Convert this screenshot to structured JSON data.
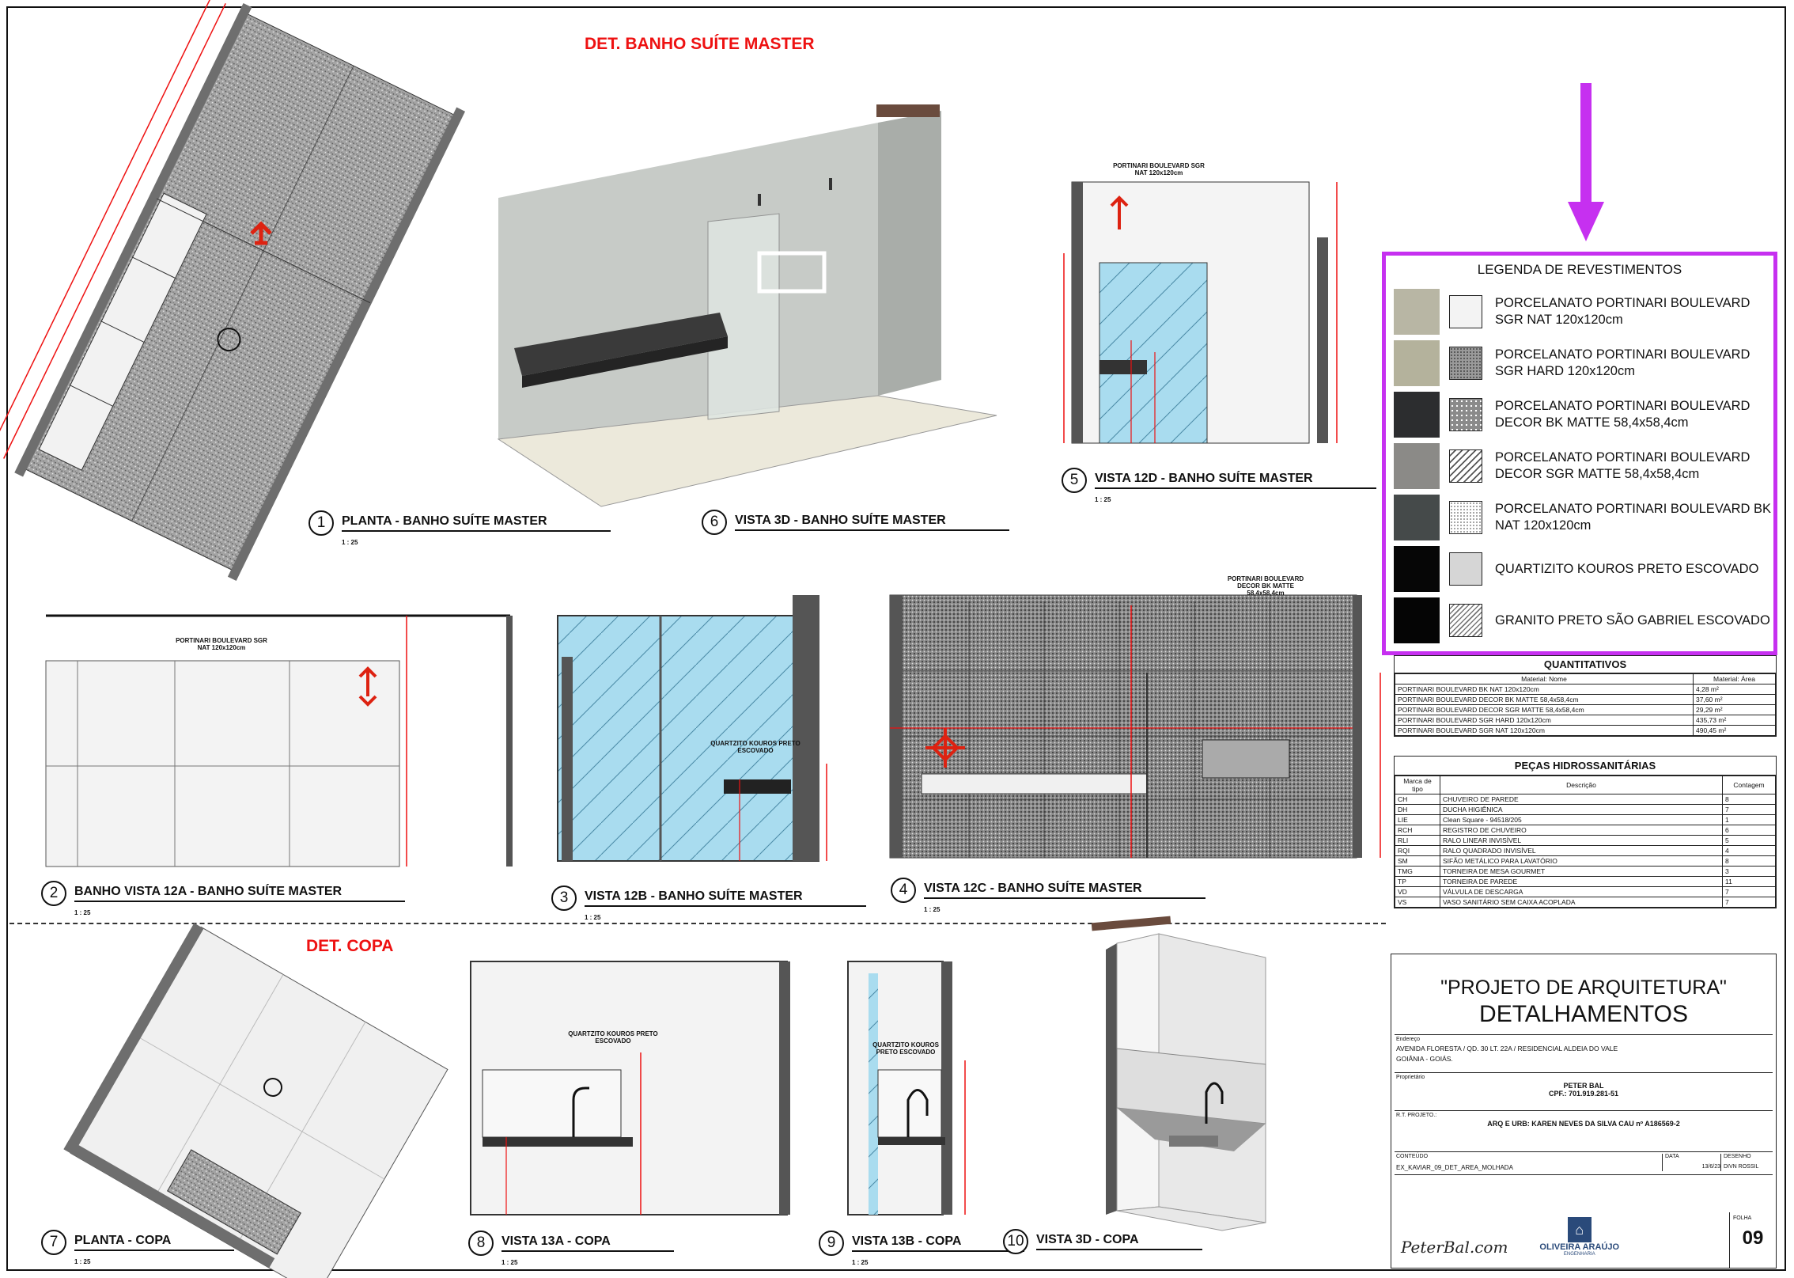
{
  "sections": {
    "bath_title": "DET. BANHO SUÍTE MASTER",
    "copa_title": "DET. COPA"
  },
  "views": [
    {
      "num": "1",
      "title": "PLANTA - BANHO SUÍTE MASTER",
      "scale": "1 : 25"
    },
    {
      "num": "6",
      "title": "VISTA 3D - BANHO SUÍTE MASTER",
      "scale": ""
    },
    {
      "num": "5",
      "title": "VISTA 12D - BANHO SUÍTE MASTER",
      "scale": "1 : 25"
    },
    {
      "num": "2",
      "title": "BANHO VISTA 12A - BANHO SUÍTE MASTER",
      "scale": "1 : 25"
    },
    {
      "num": "3",
      "title": "VISTA 12B - BANHO SUÍTE MASTER",
      "scale": "1 : 25"
    },
    {
      "num": "4",
      "title": "VISTA 12C - BANHO SUÍTE MASTER",
      "scale": "1 : 25"
    },
    {
      "num": "7",
      "title": "PLANTA - COPA",
      "scale": "1 : 25"
    },
    {
      "num": "8",
      "title": "VISTA 13A - COPA",
      "scale": "1 : 25"
    },
    {
      "num": "9",
      "title": "VISTA 13B - COPA",
      "scale": "1 : 25"
    },
    {
      "num": "10",
      "title": "VISTA 3D - COPA",
      "scale": ""
    }
  ],
  "notes": {
    "v5_top": "PORTINARI BOULEVARD SGR NAT 120x120cm",
    "v2_top": "PORTINARI BOULEVARD SGR NAT 120x120cm",
    "v3_side": "QUARTZITO KOUROS PRETO ESCOVADO",
    "v4_top": "PORTINARI BOULEVARD DECOR BK MATTE 58,4x58,4cm",
    "v8_note": "QUARTZITO KOUROS PRETO ESCOVADO",
    "v9_note": "QUARTZITO KOUROS PRETO ESCOVADO"
  },
  "legend": {
    "title": "LEGENDA DE REVESTIMENTOS",
    "items": [
      {
        "label": "PORCELANATO PORTINARI BOULEVARD SGR NAT 120x120cm",
        "color": "#b8b6a4",
        "pattern": "plain-light"
      },
      {
        "label": "PORCELANATO PORTINARI BOULEVARD SGR HARD 120x120cm",
        "color": "#b4b29c",
        "pattern": "speckle-dark"
      },
      {
        "label": "PORCELANATO PORTINARI BOULEVARD DECOR BK MATTE 58,4x58,4cm",
        "color": "#2c2d2f",
        "pattern": "dots"
      },
      {
        "label": "PORCELANATO PORTINARI BOULEVARD DECOR SGR MATTE 58,4x58,4cm",
        "color": "#8b8a87",
        "pattern": "hatch"
      },
      {
        "label": "PORCELANATO PORTINARI BOULEVARD BK NAT 120x120cm",
        "color": "#454a4a",
        "pattern": "fine-dots"
      },
      {
        "label": "QUARTIZITO KOUROS PRETO ESCOVADO",
        "color": "#060606",
        "pattern": "plain-gray"
      },
      {
        "label": "GRANITO PRETO SÃO GABRIEL ESCOVADO",
        "color": "#050505",
        "pattern": "hatch-fine"
      }
    ]
  },
  "quantitativos": {
    "title": "QUANTITATIVOS",
    "headers": [
      "Material: Nome",
      "Material: Área"
    ],
    "rows": [
      [
        "PORTINARI BOULEVARD BK NAT 120x120cm",
        "4,28 m²"
      ],
      [
        "PORTINARI BOULEVARD DECOR BK MATTE 58,4x58,4cm",
        "37,60 m²"
      ],
      [
        "PORTINARI BOULEVARD DECOR SGR MATTE 58,4x58,4cm",
        "29,29 m²"
      ],
      [
        "PORTINARI BOULEVARD SGR HARD 120x120cm",
        "435,73 m²"
      ],
      [
        "PORTINARI BOULEVARD SGR NAT 120x120cm",
        "490,45 m²"
      ]
    ]
  },
  "pecas": {
    "title": "PEÇAS HIDROSSANITÁRIAS",
    "headers": [
      "Marca de tipo",
      "Descrição",
      "Contagem"
    ],
    "rows": [
      [
        "CH",
        "CHUVEIRO DE PAREDE",
        "8"
      ],
      [
        "DH",
        "DUCHA HIGIÊNICA",
        "7"
      ],
      [
        "LIE",
        "Clean Square - 94518/205",
        "1"
      ],
      [
        "RCH",
        "REGISTRO DE CHUVEIRO",
        "6"
      ],
      [
        "RLI",
        "RALO LINEAR INVISÍVEL",
        "5"
      ],
      [
        "RQI",
        "RALO QUADRADO INVISÍVEL",
        "4"
      ],
      [
        "SM",
        "SIFÃO METÁLICO PARA LAVATÓRIO",
        "8"
      ],
      [
        "TMG",
        "TORNEIRA DE MESA GOURMET",
        "3"
      ],
      [
        "TP",
        "TORNEIRA DE PAREDE",
        "11"
      ],
      [
        "VD",
        "VÁLVULA DE DESCARGA",
        "7"
      ],
      [
        "VS",
        "VASO SANITÁRIO SEM CAIXA ACOPLADA",
        "7"
      ]
    ]
  },
  "title_block": {
    "project": "\"PROJETO DE ARQUITETURA\"",
    "subject": "DETALHAMENTOS",
    "address_label": "Endereço",
    "address1": "AVENIDA FLORESTA / QD. 30 LT. 22A / RESIDENCIAL ALDEIA DO VALE",
    "address2": "GOIÂNIA - GOIÁS.",
    "owner_label": "Proprietário",
    "owner_name": "PETER BAL",
    "owner_cpf": "CPF.: 701.919.281-51",
    "rt_label": "R.T. PROJETO.:",
    "rt_value": "ARQ E URB: KAREN NEVES DA SILVA CAU nº A186569-2",
    "file_label": "CONTEÚDO",
    "file_value": "EX_KAVIAR_09_DET_AREA_MOLHADA",
    "date_label": "DATA",
    "date_value": "13/6/23",
    "design_label": "DESENHO",
    "design_value": "DIVN ROSSIL",
    "sheet_label": "FOLHA",
    "sheet": "09",
    "logo1": "PeterBal.com",
    "logo2": "OLIVEIRA ARAÚJO",
    "logo2_sub": "ENGENHARIA"
  }
}
